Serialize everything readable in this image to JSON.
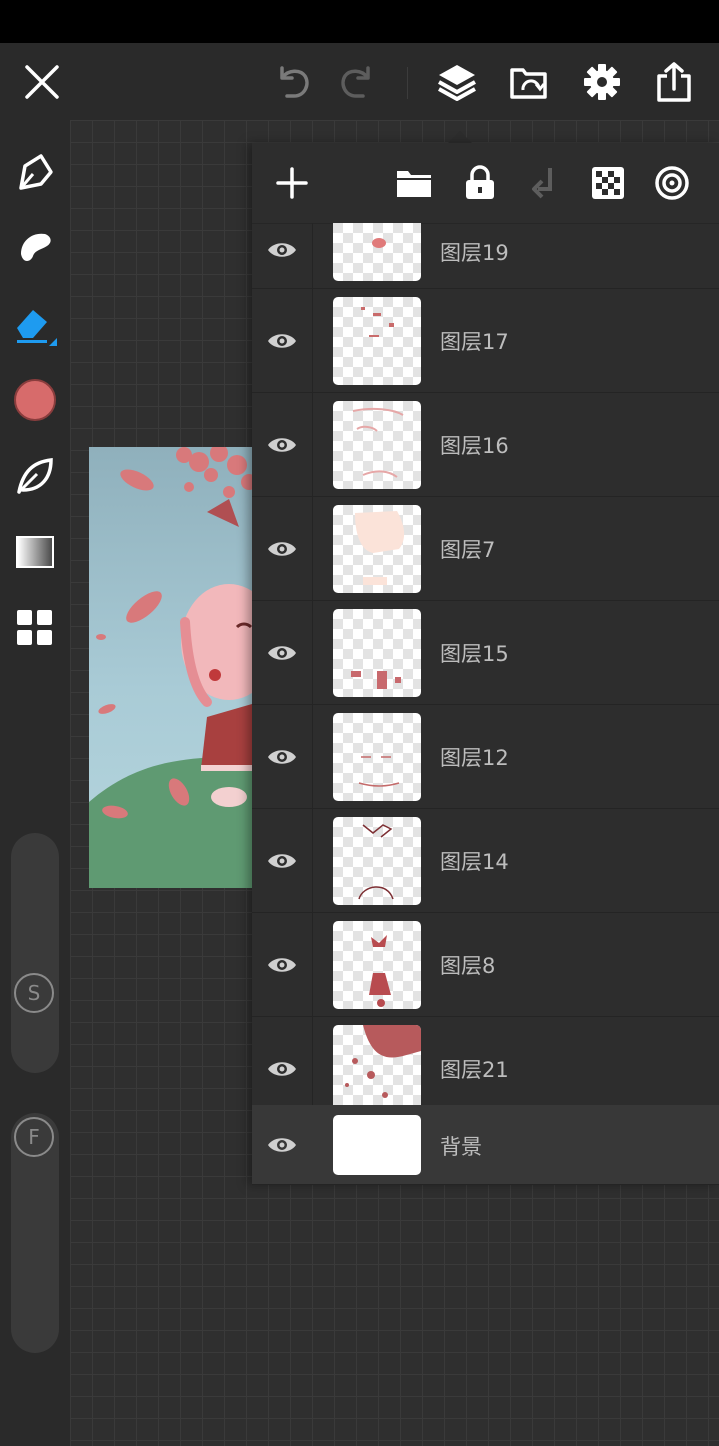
{
  "app": {
    "topbar": {
      "close_icon": "close-icon",
      "undo_icon": "undo-icon",
      "redo_icon": "redo-icon",
      "layers_icon": "layers-icon",
      "gallery_icon": "image-folder-icon",
      "settings_icon": "gear-icon",
      "share_icon": "share-icon"
    },
    "left_toolbar": {
      "tools": [
        "pen-icon",
        "smudge-icon",
        "eraser-icon",
        "color-swatch",
        "leaf-icon",
        "gradient-icon",
        "grid-apps-icon"
      ],
      "active_tool": "eraser-icon",
      "current_color": "#d76b6b",
      "size_slider_label": "S",
      "flow_slider_label": "F"
    },
    "layers_panel": {
      "toolbar": [
        "add-icon",
        "folder-icon",
        "lock-icon",
        "merge-down-icon",
        "transparency-icon",
        "target-icon"
      ],
      "add_label": "+",
      "layers": [
        {
          "name": "图层19",
          "visible": true
        },
        {
          "name": "图层17",
          "visible": true
        },
        {
          "name": "图层16",
          "visible": true
        },
        {
          "name": "图层7",
          "visible": true
        },
        {
          "name": "图层15",
          "visible": true
        },
        {
          "name": "图层12",
          "visible": true
        },
        {
          "name": "图层14",
          "visible": true
        },
        {
          "name": "图层8",
          "visible": true
        },
        {
          "name": "图层21",
          "visible": true
        }
      ],
      "background_layer": {
        "name": "背景",
        "visible": true
      }
    },
    "colors": {
      "accent": "#1e9bf0",
      "background": "#2b2b2b",
      "panel": "#2d2d2d",
      "icon": "#ffffff",
      "icon_disabled": "#7a7a7a"
    }
  }
}
